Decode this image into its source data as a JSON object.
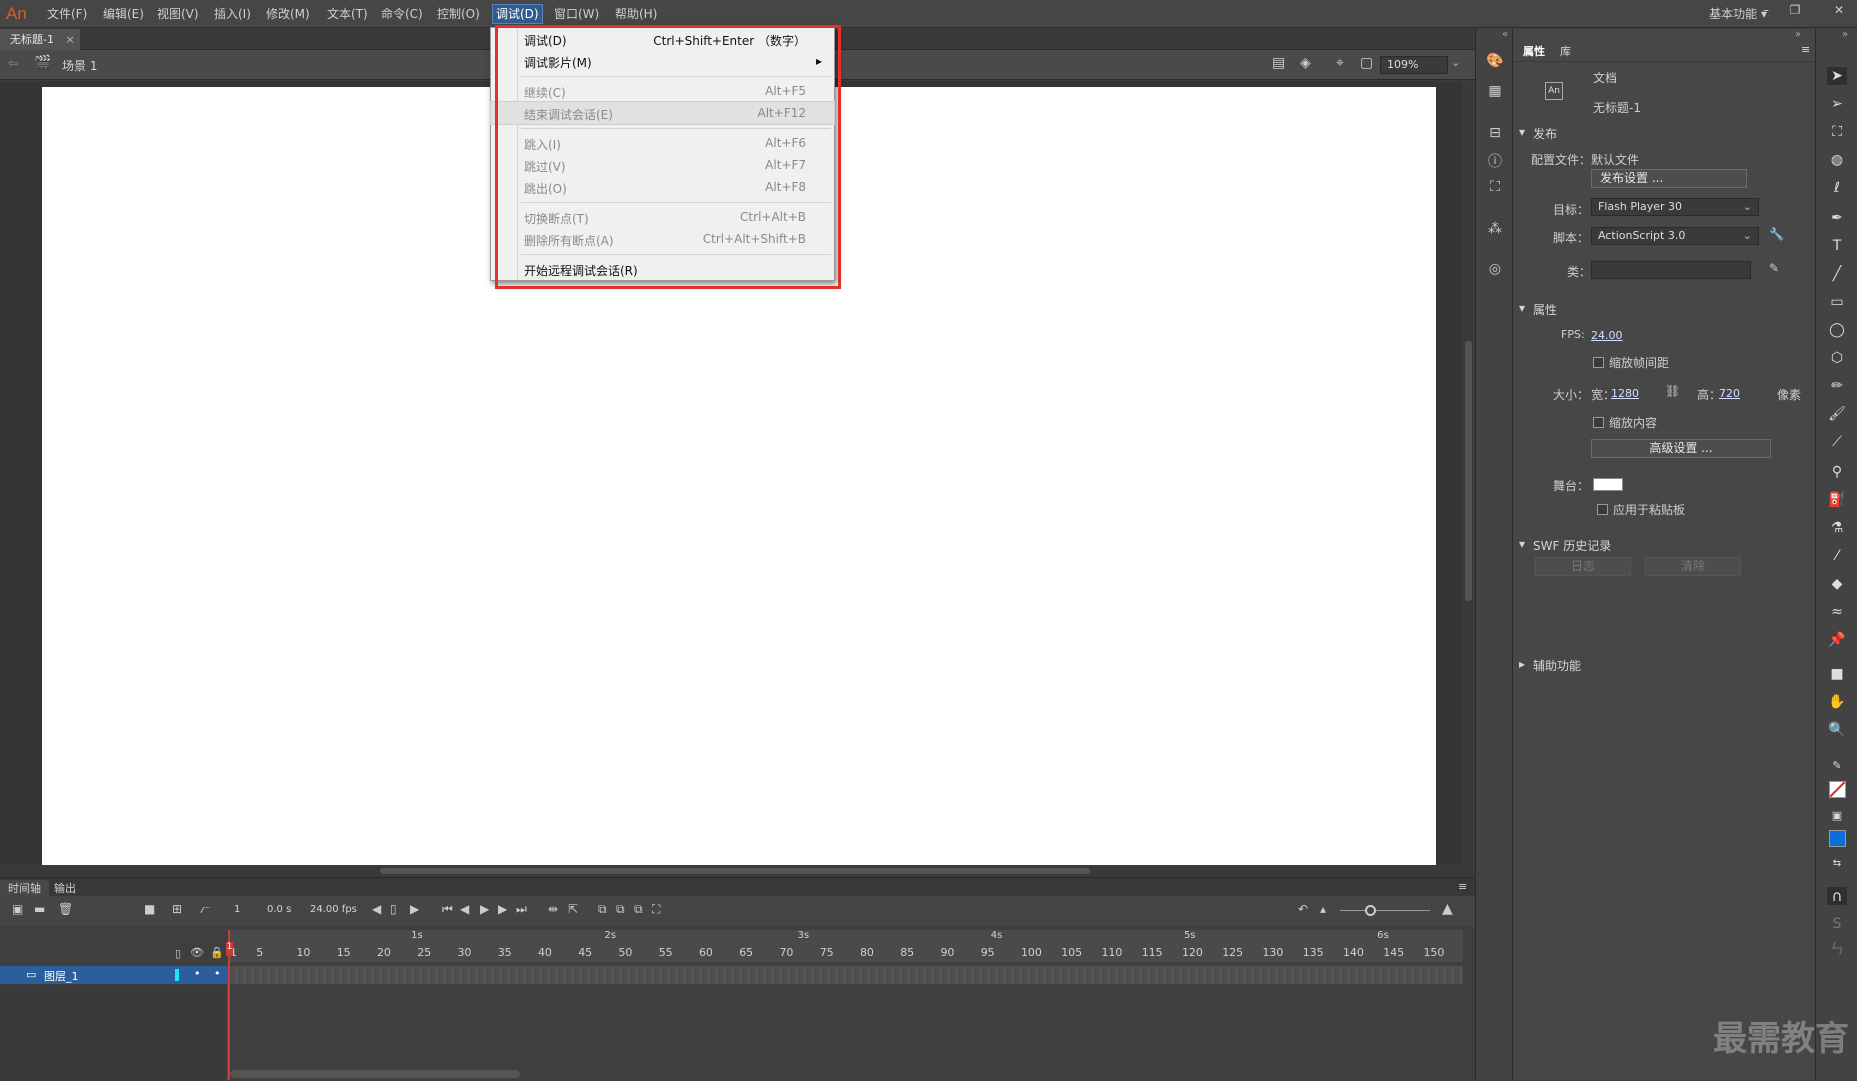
{
  "app": {
    "logo": "An"
  },
  "menubar": {
    "items": [
      "文件(F)",
      "编辑(E)",
      "视图(V)",
      "插入(I)",
      "修改(M)",
      "文本(T)",
      "命令(C)",
      "控制(O)",
      "调试(D)",
      "窗口(W)",
      "帮助(H)"
    ],
    "active_index": 8,
    "workspace": "基本功能 ▾"
  },
  "doc": {
    "tab": "无标题-1",
    "tab_close": "×",
    "scene": "场景 1",
    "zoom": "109%"
  },
  "debug_menu": [
    {
      "label": "调试(D)",
      "shortcut": "Ctrl+Shift+Enter （数字）",
      "disabled": false
    },
    {
      "label": "调试影片(M)",
      "shortcut": "▸",
      "disabled": false
    },
    {
      "label": "继续(C)",
      "shortcut": "Alt+F5",
      "disabled": true
    },
    {
      "label": "结束调试会话(E)",
      "shortcut": "Alt+F12",
      "disabled": true
    },
    {
      "label": "跳入(I)",
      "shortcut": "Alt+F6",
      "disabled": true
    },
    {
      "label": "跳过(V)",
      "shortcut": "Alt+F7",
      "disabled": true
    },
    {
      "label": "跳出(O)",
      "shortcut": "Alt+F8",
      "disabled": true
    },
    {
      "label": "切换断点(T)",
      "shortcut": "Ctrl+Alt+B",
      "disabled": true
    },
    {
      "label": "删除所有断点(A)",
      "shortcut": "Ctrl+Alt+Shift+B",
      "disabled": true
    },
    {
      "label": "开始远程调试会话(R)",
      "shortcut": "",
      "disabled": false
    }
  ],
  "timeline": {
    "tabs": [
      "时间轴",
      "输出"
    ],
    "frame": "1",
    "time": "0.0 s",
    "fps": "24.00 fps",
    "layer": "图层_1",
    "seconds": [
      "1s",
      "2s",
      "3s",
      "4s",
      "5s",
      "6s"
    ],
    "frame_ticks": [
      "1",
      "5",
      "10",
      "15",
      "20",
      "25",
      "30",
      "35",
      "40",
      "45",
      "50",
      "55",
      "60",
      "65",
      "70",
      "75",
      "80",
      "85",
      "90",
      "95",
      "100",
      "105",
      "110",
      "115",
      "120",
      "125",
      "130",
      "135",
      "140",
      "145",
      "150"
    ]
  },
  "properties": {
    "tabs": [
      "属性",
      "库"
    ],
    "doc_type": "文档",
    "doc_name": "无标题-1",
    "doc_icon": "An",
    "publish_section": "发布",
    "profile_label": "配置文件：",
    "profile_value": "默认文件",
    "publish_settings": "发布设置 ...",
    "target_label": "目标：",
    "target_value": "Flash Player 30",
    "script_label": "脚本：",
    "script_value": "ActionScript 3.0",
    "class_label": "类：",
    "props_section": "属性",
    "fps_label": "FPS:",
    "fps_value": "24.00",
    "scale_spans": "缩放帧间距",
    "size_label": "大小：",
    "width_label": "宽：",
    "width_value": "1280",
    "height_label": "高：",
    "height_value": "720",
    "unit": "像素",
    "scale_content": "缩放内容",
    "advanced": "高级设置 ...",
    "stage_label": "舞台：",
    "apply_pasteboard": "应用于粘贴板",
    "swf_section": "SWF 历史记录",
    "log_btn": "日志",
    "clear_btn": "清除",
    "accessibility": "辅助功能"
  },
  "watermark": "最需教育",
  "colors": {
    "accent": "#2f5b8d",
    "highlight_box": "#e03030",
    "fill_color": "#0a6fd6"
  }
}
